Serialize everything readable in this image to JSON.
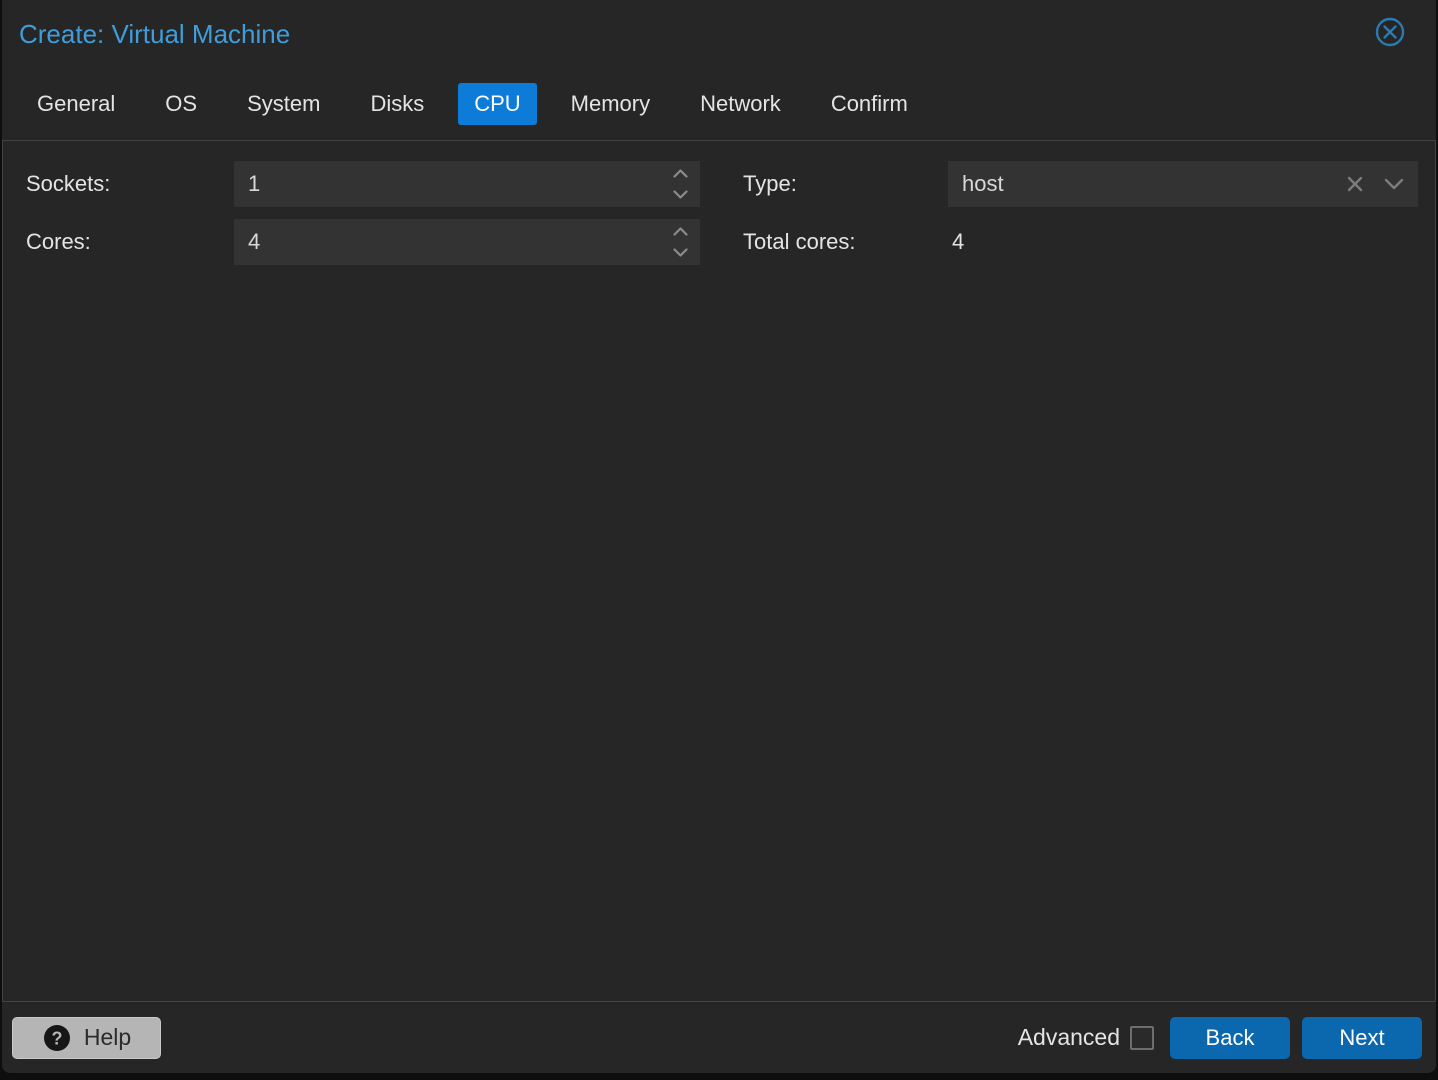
{
  "dialog": {
    "title": "Create: Virtual Machine"
  },
  "tabs": [
    {
      "label": "General",
      "active": false
    },
    {
      "label": "OS",
      "active": false
    },
    {
      "label": "System",
      "active": false
    },
    {
      "label": "Disks",
      "active": false
    },
    {
      "label": "CPU",
      "active": true
    },
    {
      "label": "Memory",
      "active": false
    },
    {
      "label": "Network",
      "active": false
    },
    {
      "label": "Confirm",
      "active": false
    }
  ],
  "form": {
    "sockets": {
      "label": "Sockets:",
      "value": "1"
    },
    "cores": {
      "label": "Cores:",
      "value": "4"
    },
    "type": {
      "label": "Type:",
      "value": "host"
    },
    "total_cores": {
      "label": "Total cores:",
      "value": "4"
    }
  },
  "footer": {
    "help_label": "Help",
    "advanced_label": "Advanced",
    "advanced_checked": false,
    "back_label": "Back",
    "next_label": "Next"
  },
  "icons": {
    "close": "close-circle-icon",
    "help": "question-circle-icon",
    "spinner_up": "chevron-up-icon",
    "spinner_down": "chevron-down-icon",
    "combo_clear": "clear-x-icon",
    "combo_open": "chevron-down-icon"
  },
  "colors": {
    "dialog_background": "#262626",
    "field_background": "#333333",
    "panel_border": "#434343",
    "title_blue": "#3f9ddb",
    "active_tab_blue": "#0d7cd8",
    "button_blue": "#0b67ae",
    "help_gray": "#b5b5b5",
    "text": "#e4e4e4"
  }
}
